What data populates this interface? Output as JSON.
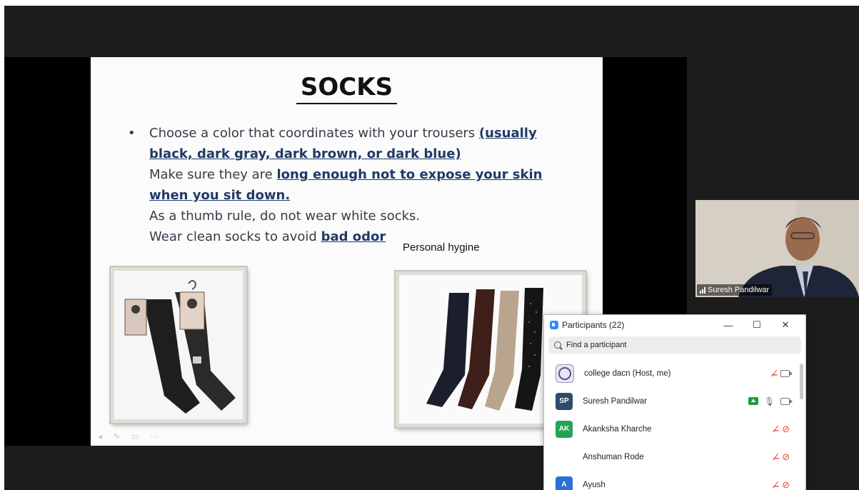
{
  "slide": {
    "title": "SOCKS",
    "bullet": "•",
    "line1_text": "Choose a color that coordinates with your trousers ",
    "line1_bold": "(usually",
    "line2_bold": "black, dark gray, dark brown, or dark blue)",
    "line3_text": "Make sure they are ",
    "line3_bold": "long enough not to expose your skin",
    "line4_bold": "when you sit down.",
    "line5_text": "As a thumb rule, do not wear white socks.",
    "line6_text": "Wear clean socks to avoid ",
    "line6_bold": "bad odor",
    "caption": "Personal hygine"
  },
  "video": {
    "name": "Suresh Pandilwar"
  },
  "participants_panel": {
    "title": "Participants (22)",
    "minimize": "—",
    "maximize": "☐",
    "close": "✕",
    "search_placeholder": "Find a participant",
    "participants": [
      {
        "name": "college dacn (Host, me)",
        "initials": "",
        "avatar_color": "#e9e6f2",
        "mic": "muted",
        "cam": "on"
      },
      {
        "name": "Suresh Pandilwar",
        "initials": "SP",
        "avatar_color": "#2f4a6b",
        "mic": "on",
        "cam": "on",
        "sharing": true
      },
      {
        "name": "Akanksha Kharche",
        "initials": "AK",
        "avatar_color": "#23a455",
        "mic": "muted",
        "cam": "off"
      },
      {
        "name": "Anshuman Rode",
        "initials": "",
        "avatar_color": "",
        "mic": "muted",
        "cam": "off"
      },
      {
        "name": "Ayush",
        "initials": "A",
        "avatar_color": "#2d6fd6",
        "mic": "muted",
        "cam": "off"
      }
    ]
  }
}
